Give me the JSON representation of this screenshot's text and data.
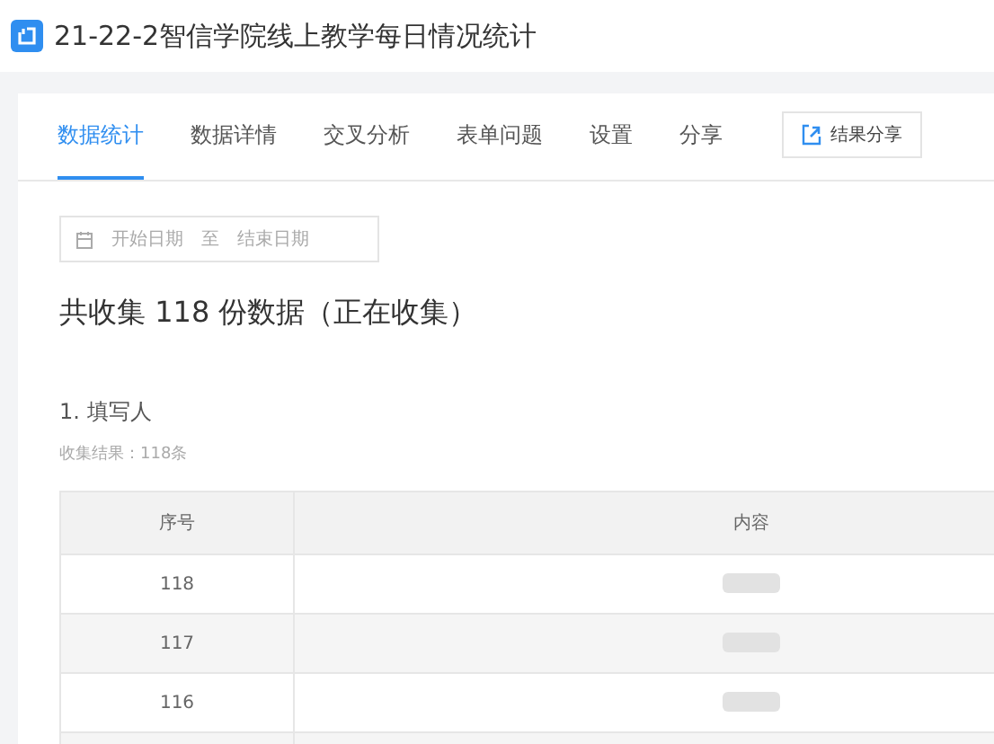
{
  "header": {
    "title": "21-22-2智信学院线上教学每日情况统计"
  },
  "tabs": [
    {
      "label": "数据统计",
      "selected": true
    },
    {
      "label": "数据详情",
      "selected": false
    },
    {
      "label": "交叉分析",
      "selected": false
    },
    {
      "label": "表单问题",
      "selected": false
    },
    {
      "label": "设置",
      "selected": false
    },
    {
      "label": "分享",
      "selected": false
    }
  ],
  "share_button": {
    "label": "结果分享"
  },
  "date_range": {
    "start_placeholder": "开始日期",
    "separator": "至",
    "end_placeholder": "结束日期"
  },
  "summary": "共收集 118 份数据（正在收集）",
  "question": {
    "title": "1. 填写人",
    "result": "收集结果：118条"
  },
  "table": {
    "columns": [
      "序号",
      "内容"
    ],
    "rows": [
      {
        "index": "118",
        "redacted": true
      },
      {
        "index": "117",
        "redacted": true
      },
      {
        "index": "116",
        "redacted": true
      },
      {
        "index": "",
        "redacted": false
      }
    ]
  }
}
